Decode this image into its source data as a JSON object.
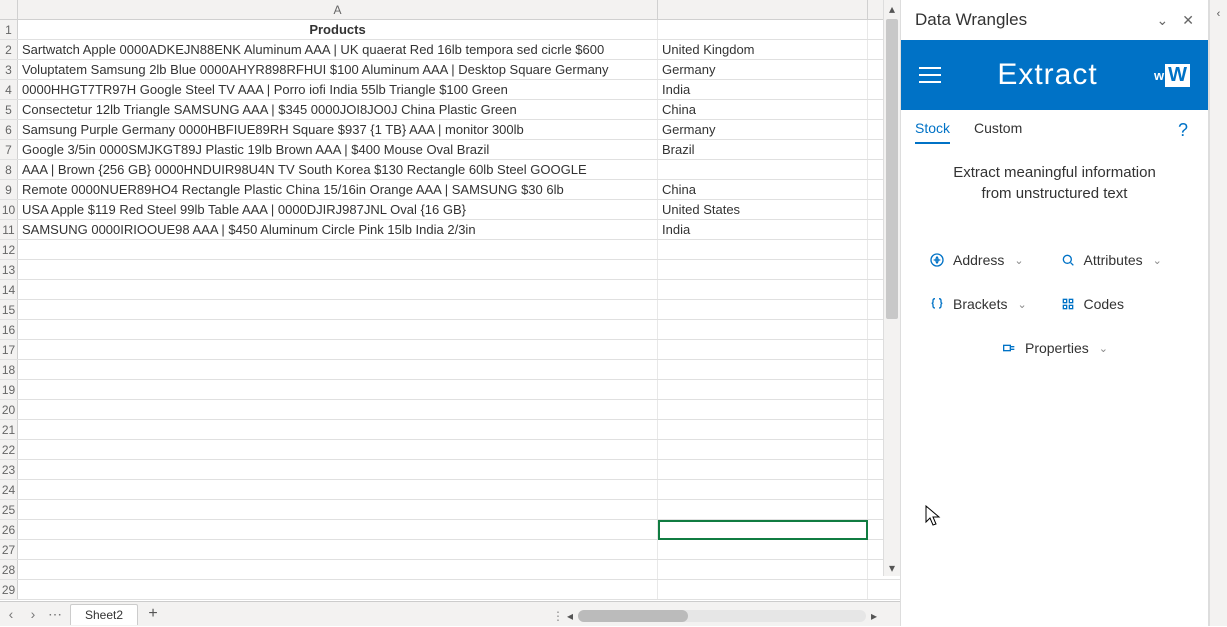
{
  "grid": {
    "columns": [
      "A"
    ],
    "header": {
      "A": "Products"
    },
    "rows": [
      {
        "A": "Sartwatch Apple      0000ADKEJN88ENK Aluminum AAA | UK  quaerat Red 16lb tempora sed cicrle $600",
        "B": "United Kingdom"
      },
      {
        "A": "Voluptatem Samsung       2lb Blue 0000AHYR898RFHUI $100 Aluminum AAA | Desktop Square Germany",
        "B": "Germany"
      },
      {
        "A": "0000HHGT7TR97H Google      Steel TV AAA | Porro iofi India 55lb Triangle $100 Green",
        "B": "India"
      },
      {
        "A": "Consectetur 12lb Triangle   SAMSUNG      AAA | $345 0000JOI8JO0J China Plastic Green",
        "B": "China"
      },
      {
        "A": "Samsung       Purple Germany 0000HBFIUE89RH Square $937 {1 TB} AAA |  monitor 300lb",
        "B": "Germany"
      },
      {
        "A": "Google      3/5in  0000SMJKGT89J  Plastic 19lb Brown AAA | $400 Mouse Oval Brazil",
        "B": "Brazil"
      },
      {
        "A": "AAA | Brown {256 GB} 0000HNDUIR98U4N TV South Korea  $130  Rectangle 60lb Steel GOOGLE",
        "B": ""
      },
      {
        "A": "Remote 0000NUER89HO4 Rectangle Plastic China 15/16in   Orange AAA | SAMSUNG       $30 6lb",
        "B": "China"
      },
      {
        "A": "USA Apple       $119 Red Steel 99lb Table AAA | 0000DJIRJ987JNL Oval {16 GB}",
        "B": "United States"
      },
      {
        "A": "SAMSUNG       0000IRIOOUE98   AAA | $450 Aluminum Circle Pink 15lb India 2/3in",
        "B": "India"
      }
    ],
    "totalRows": 29,
    "selectedCell": "B26"
  },
  "sheetTabs": {
    "active": "Sheet2"
  },
  "panel": {
    "title": "Data Wrangles",
    "feature": "Extract",
    "tabs": {
      "stock": "Stock",
      "custom": "Custom",
      "active": "stock"
    },
    "description1": "Extract meaningful information",
    "description2": "from unstructured text",
    "options": {
      "address": "Address",
      "attributes": "Attributes",
      "brackets": "Brackets",
      "codes": "Codes",
      "properties": "Properties"
    }
  }
}
